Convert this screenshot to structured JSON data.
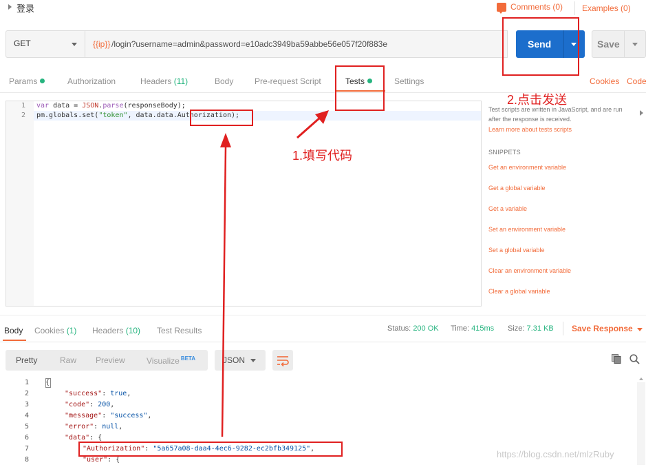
{
  "top": {
    "request_name": "登录",
    "comments_label": "Comments (0)",
    "examples_label": "Examples (0)"
  },
  "url_bar": {
    "method": "GET",
    "url_variable": "{{ip}}",
    "url_path": "/login?username=admin&password=e10adc3949ba59abbe56e057f20f883e",
    "send_label": "Send",
    "save_label": "Save"
  },
  "request_tabs": {
    "params": "Params",
    "authorization": "Authorization",
    "headers": "Headers",
    "headers_count": "(11)",
    "body": "Body",
    "prerequest": "Pre-request Script",
    "tests": "Tests",
    "settings": "Settings",
    "cookies_link": "Cookies",
    "code_link": "Code"
  },
  "editor": {
    "line_numbers": [
      "1",
      "2"
    ],
    "line1": {
      "kw_var": "var",
      "t1": " data = ",
      "obj": "JSON",
      "t2": ".",
      "fn": "parse",
      "t3": "(responseBody);"
    },
    "line2": {
      "t1": "pm.globals.set(",
      "str": "\"token\"",
      "t2": ", data.data.Authorization);"
    }
  },
  "snippets": {
    "description": "Test scripts are written in JavaScript, and are run after the response is received.",
    "learn_more": "Learn more about tests scripts",
    "heading": "SNIPPETS",
    "items": [
      "Get an environment variable",
      "Get a global variable",
      "Get a variable",
      "Set an environment variable",
      "Set a global variable",
      "Clear an environment variable",
      "Clear a global variable"
    ]
  },
  "response": {
    "tabs": {
      "body": "Body",
      "cookies": "Cookies",
      "cookies_count": "(1)",
      "headers": "Headers",
      "headers_count": "(10)",
      "test_results": "Test Results"
    },
    "status": {
      "status_label": "Status:",
      "status_value": "200 OK",
      "time_label": "Time:",
      "time_value": "415ms",
      "size_label": "Size:",
      "size_value": "7.31 KB",
      "save_response": "Save Response"
    },
    "view": {
      "pretty": "Pretty",
      "raw": "Raw",
      "preview": "Preview",
      "visualize": "Visualize",
      "beta": "BETA",
      "format": "JSON"
    },
    "line_numbers": [
      "1",
      "2",
      "3",
      "4",
      "5",
      "6",
      "7",
      "8"
    ],
    "json": {
      "l1": "{",
      "l2_key": "\"success\"",
      "l2_val": "true",
      "l3_key": "\"code\"",
      "l3_val": "200",
      "l4_key": "\"message\"",
      "l4_val": "\"success\"",
      "l5_key": "\"error\"",
      "l5_val": "null",
      "l6_key": "\"data\"",
      "l6_val": "{",
      "l7_key": "\"Authorization\"",
      "l7_val": "\"5a657a08-daa4-4ec6-9282-ec2bfb349125\"",
      "l8_key": "\"user\"",
      "l8_val": "{"
    }
  },
  "annotations": {
    "step1": "1.填写代码",
    "step2": "2.点击发送"
  },
  "watermark": "https://blog.csdn.net/mlzRuby",
  "colors": {
    "accent_orange": "#f26b3a",
    "send_blue": "#1c6ecc",
    "status_green": "#26b47f",
    "annotation_red": "#e02020"
  }
}
